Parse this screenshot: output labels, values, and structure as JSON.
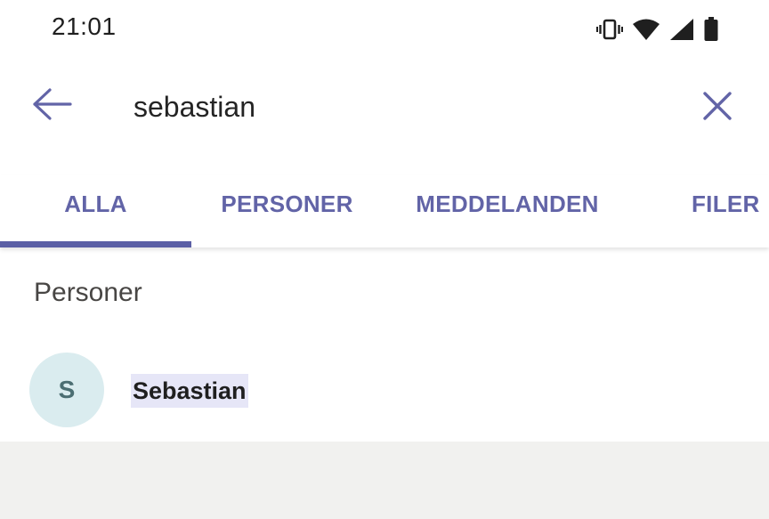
{
  "status_bar": {
    "time": "21:01",
    "icons": [
      "vibrate-icon",
      "wifi-icon",
      "signal-icon",
      "battery-icon"
    ]
  },
  "search": {
    "query": "sebastian",
    "back_icon": "arrow-left-icon",
    "clear_icon": "close-icon"
  },
  "tabs": [
    {
      "label": "ALLA",
      "active": true
    },
    {
      "label": "PERSONER",
      "active": false
    },
    {
      "label": "MEDDELANDEN",
      "active": false
    },
    {
      "label": "FILER",
      "active": false
    }
  ],
  "results": {
    "section_heading": "Personer",
    "people": [
      {
        "initial": "S",
        "name": "Sebastian"
      }
    ]
  },
  "colors": {
    "accent": "#6264a7",
    "indicator": "#5b5fa5",
    "highlight": "#e6e6f7",
    "avatar_bg": "#daecef",
    "avatar_fg": "#4b6e72",
    "bottom_bg": "#f1f1ef"
  }
}
